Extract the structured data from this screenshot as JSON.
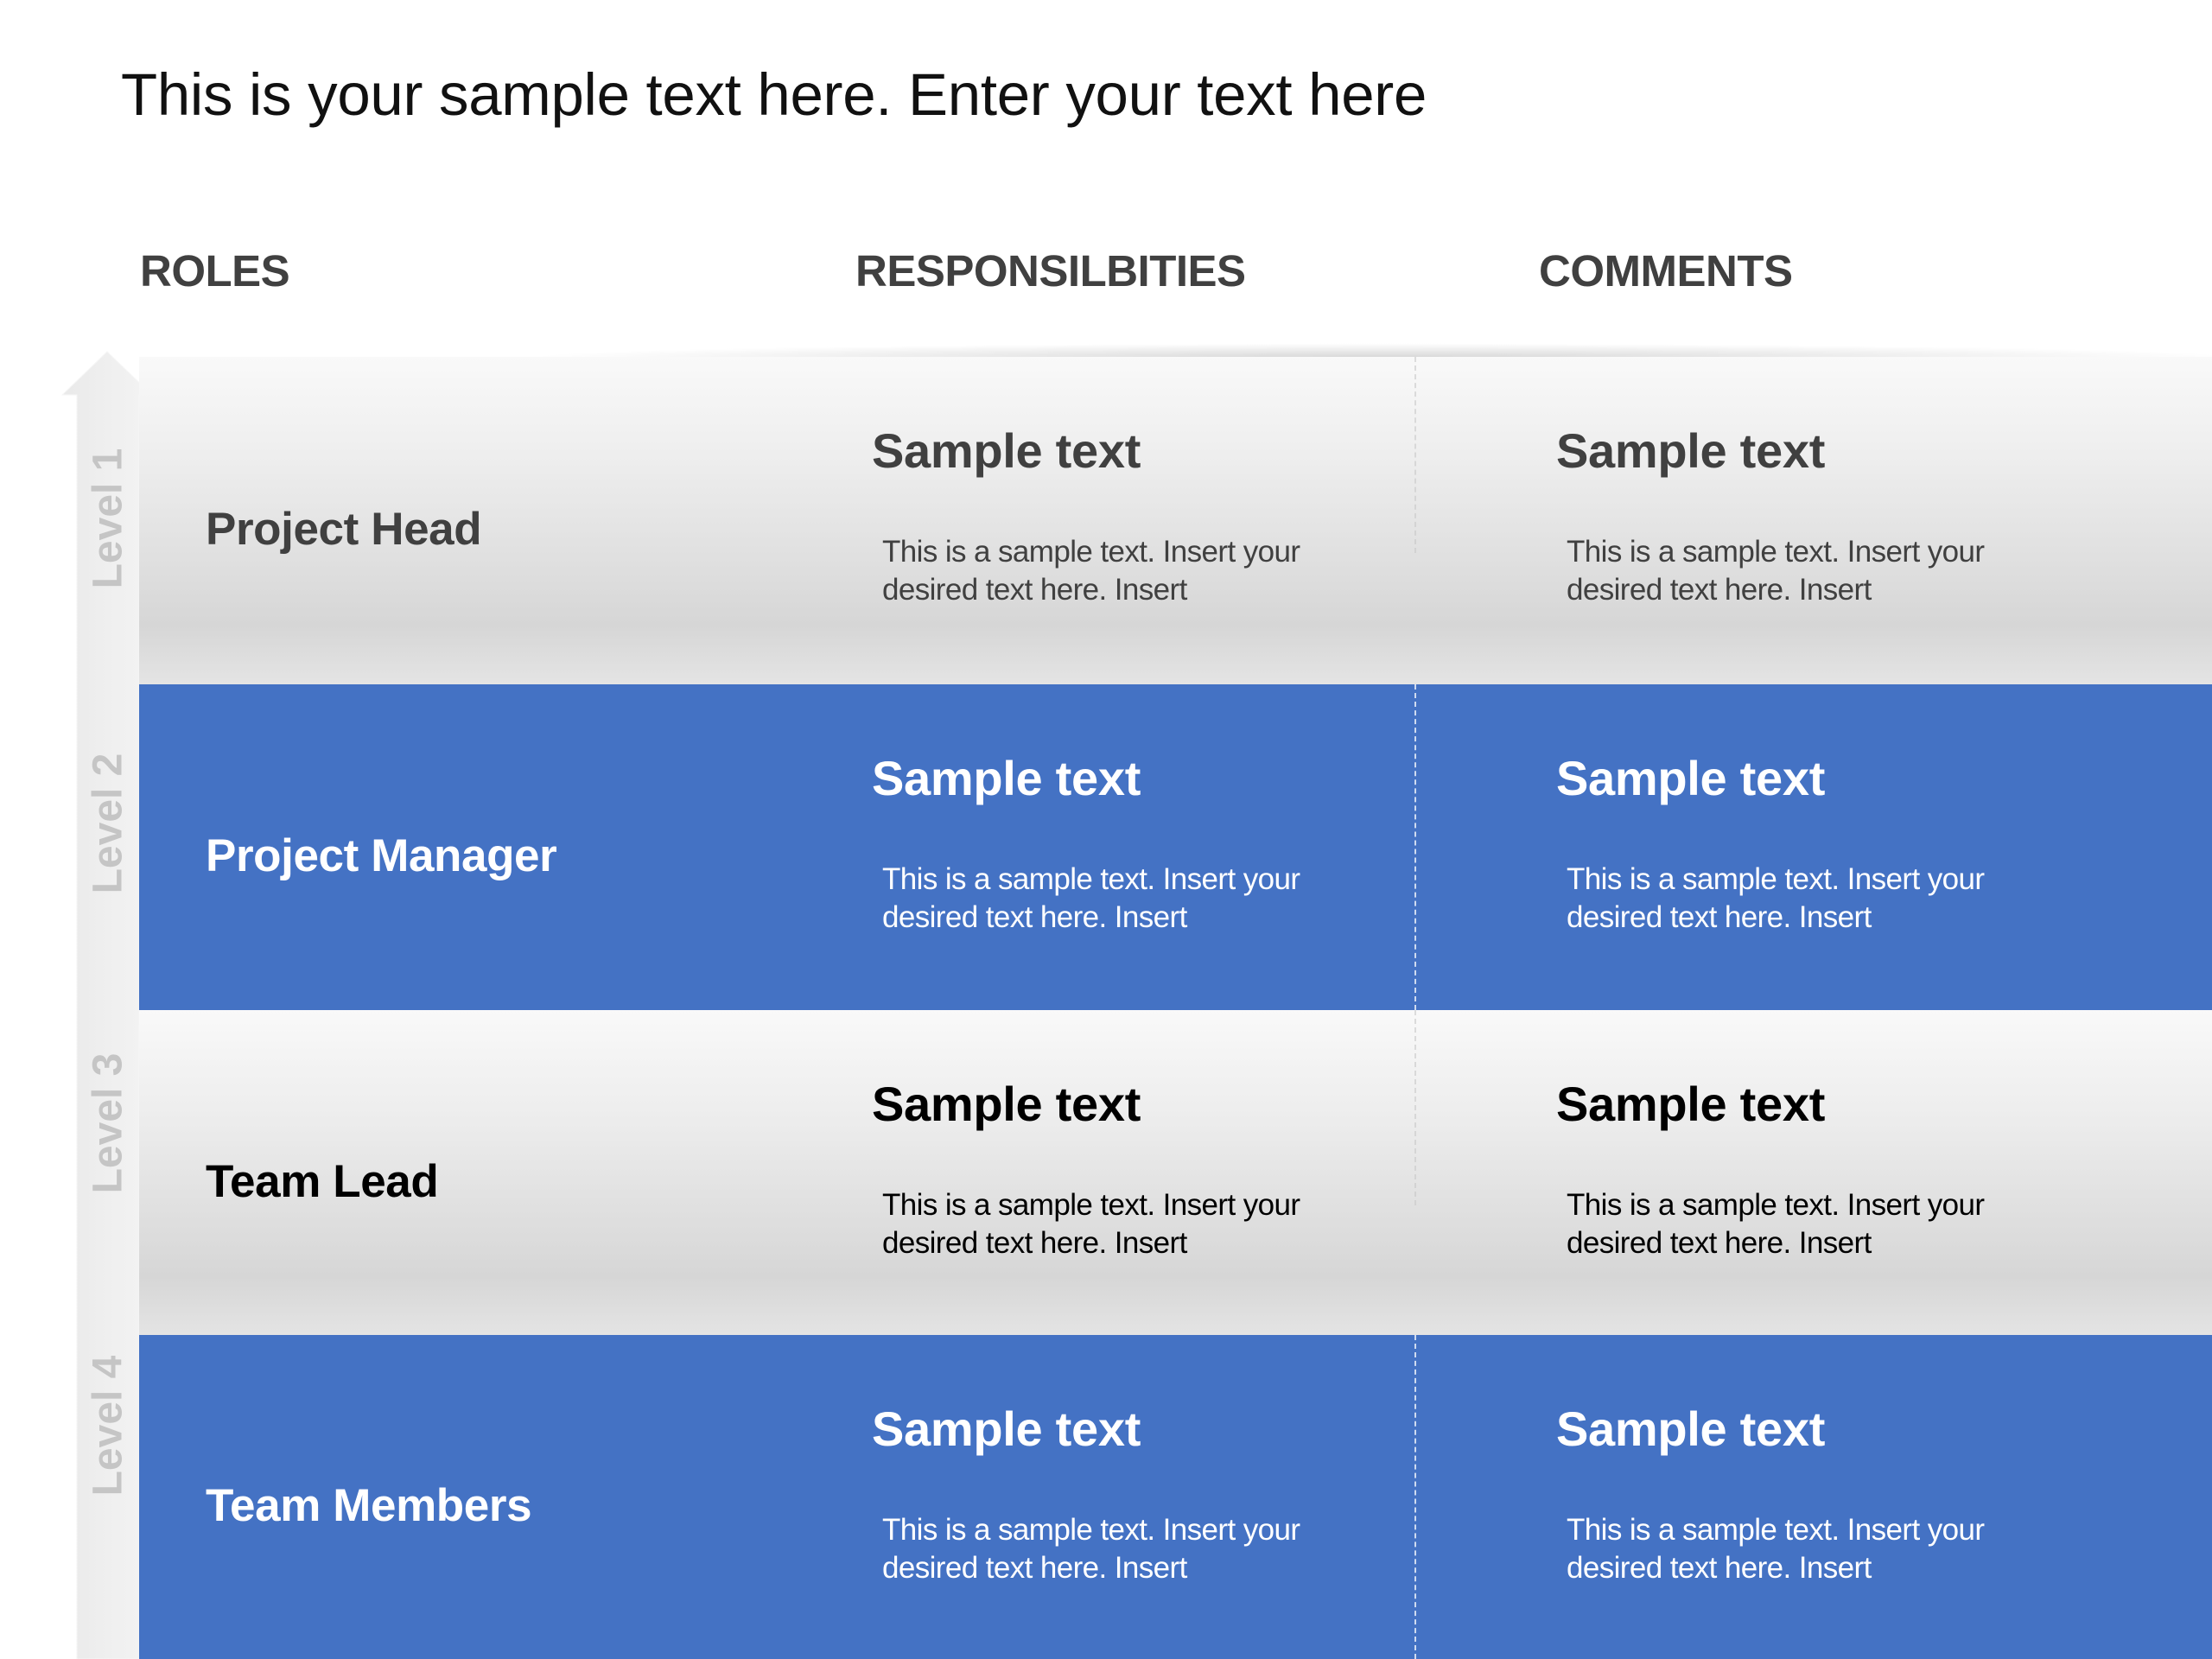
{
  "slide": {
    "title": "This is your sample text here. Enter your text here"
  },
  "headers": {
    "roles": "ROLES",
    "responsibilities": "RESPONSILBITIES",
    "comments": "COMMENTS"
  },
  "levels": [
    "Level 1",
    "Level 2",
    "Level 3",
    "Level 4"
  ],
  "colors": {
    "accent_blue": "#4472C4",
    "header_text": "#404040",
    "level_text": "#C5C5C5"
  },
  "rows": [
    {
      "role": "Project Head",
      "style": "gray",
      "responsibility": {
        "title": "Sample text",
        "body": "This is a sample text. Insert your desired text here. Insert"
      },
      "comment": {
        "title": "Sample text",
        "body": "This is a sample text. Insert your desired text here. Insert"
      }
    },
    {
      "role": "Project Manager",
      "style": "blue",
      "responsibility": {
        "title": "Sample text",
        "body": "This is a sample text. Insert your desired text here. Insert"
      },
      "comment": {
        "title": "Sample text",
        "body": "This is a sample text. Insert your desired text here. Insert"
      }
    },
    {
      "role": "Team Lead",
      "style": "gray",
      "responsibility": {
        "title": "Sample text",
        "body": "This is a sample text. Insert your desired text here. Insert"
      },
      "comment": {
        "title": "Sample text",
        "body": "This is a sample text. Insert your desired text here. Insert"
      }
    },
    {
      "role": "Team Members",
      "style": "blue",
      "responsibility": {
        "title": "Sample text",
        "body": "This is a sample text. Insert your desired text here. Insert"
      },
      "comment": {
        "title": "Sample text",
        "body": "This is a sample text. Insert your desired text here. Insert"
      }
    }
  ]
}
